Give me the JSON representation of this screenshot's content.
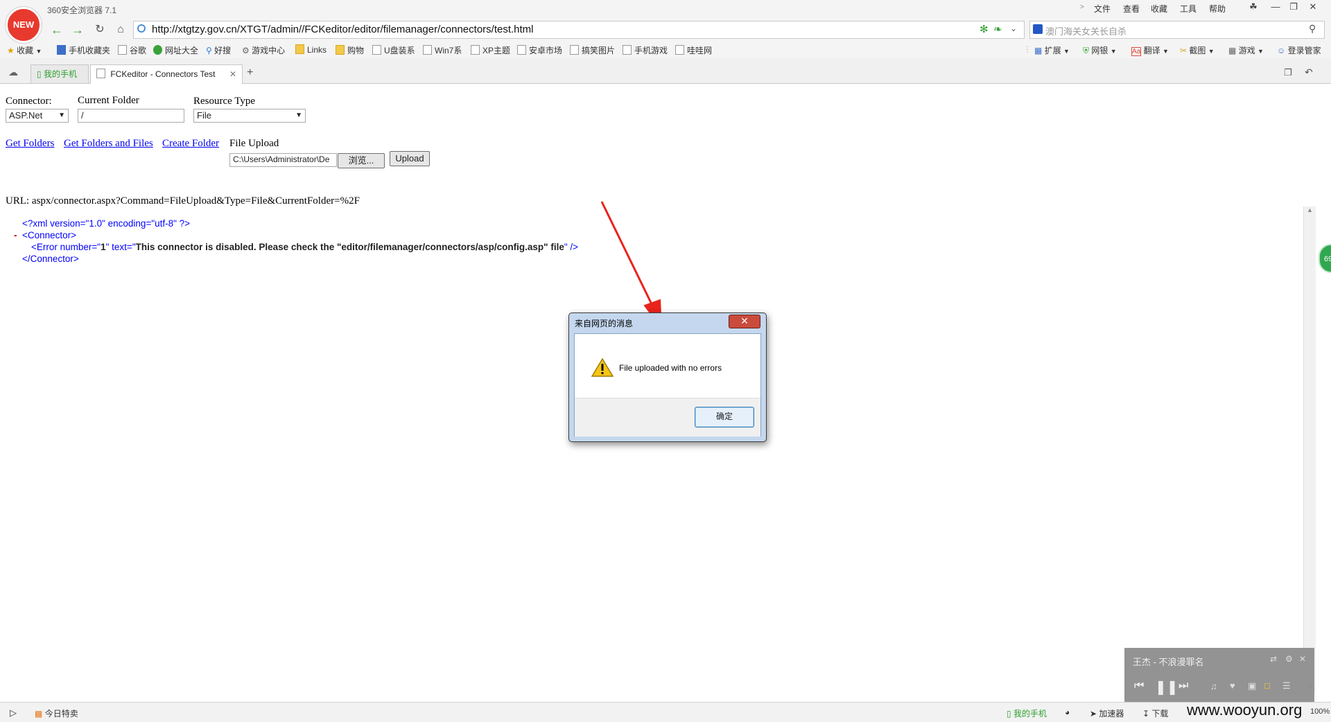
{
  "browser": {
    "app_title": "360安全浏览器 7.1",
    "logo_badge": "NEW",
    "menu": [
      "文件",
      "查看",
      "收藏",
      "工具",
      "帮助"
    ],
    "address_url": "http://xtgtzy.gov.cn/XTGT/admin//FCKeditor/editor/filemanager/connectors/test.html",
    "search_placeholder": "澳门海关女关长自杀"
  },
  "bookmarks": {
    "left": [
      "收藏",
      "手机收藏夹",
      "谷歌",
      "网址大全",
      "好搜",
      "游戏中心",
      "Links",
      "购物",
      "U盘装系",
      "Win7系",
      "XP主题",
      "安卓市场",
      "搞笑图片",
      "手机游戏",
      "哇哇网"
    ],
    "right": [
      "扩展",
      "网银",
      "翻译",
      "截图",
      "游戏",
      "登录管家"
    ]
  },
  "tabs": {
    "mobile": "我的手机",
    "active": "FCKeditor - Connectors Test",
    "new_tab": "+"
  },
  "form": {
    "connector_label": "Connector:",
    "connector_value": "ASP.Net",
    "folder_label": "Current Folder",
    "folder_value": "/",
    "resource_label": "Resource Type",
    "resource_value": "File",
    "link_get_folders": "Get Folders",
    "link_get_folders_files": "Get Folders and Files",
    "link_create_folder": "Create Folder",
    "upload_label": "File Upload",
    "file_path": "C:\\Users\\Administrator\\De",
    "browse_button": "浏览...",
    "upload_button": "Upload"
  },
  "result": {
    "url_line": "URL: aspx/connector.aspx?Command=FileUpload&Type=File&CurrentFolder=%2F",
    "xml_decl": "<?xml version=\"1.0\" encoding=\"utf-8\" ?>",
    "collapse_marker": "-",
    "connector_open": "<Connector>",
    "error_tag_open": "<Error number=\"",
    "error_number": "1",
    "error_attr_text": "\" text=\"",
    "error_text": "This connector is disabled. Please check the \"editor/filemanager/connectors/asp/config.asp\" file",
    "error_tag_close": "\" />",
    "connector_close": "</Connector>"
  },
  "dialog": {
    "title": "来自网页的消息",
    "close": "✕",
    "message": "File uploaded with no errors",
    "ok_button": "确定"
  },
  "side_badge": "69",
  "music": {
    "track": "王杰 - 不浪漫罪名"
  },
  "status": {
    "today_sale": "今日特卖",
    "mobile": "我的手机",
    "accelerator": "加速器",
    "download": "下载",
    "zoom": "100%",
    "watermark": "www.wooyun.org"
  },
  "colors": {
    "link": "#0000ee",
    "xml_markup": "#0000ff",
    "xml_value": "#990000",
    "arrow": "#e8241c",
    "nav_green": "#3a9a3a"
  }
}
